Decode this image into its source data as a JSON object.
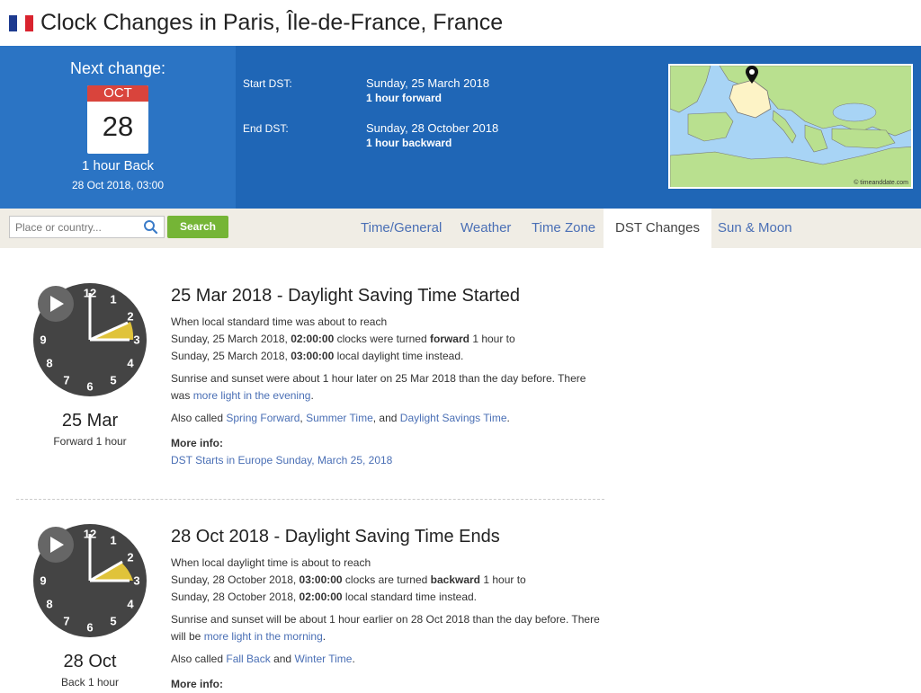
{
  "page": {
    "title": "Clock Changes in Paris, Île-de-France, France"
  },
  "colors": {
    "banner": "#1f66b6",
    "banner_left": "#2b74c4",
    "search_button": "#75b536",
    "link": "#4a6fb5",
    "calendar_month": "#d9443c"
  },
  "next_change": {
    "heading": "Next change:",
    "month": "OCT",
    "day": "28",
    "desc": "1 hour Back",
    "datetime": "28 Oct 2018, 03:00"
  },
  "dst": {
    "start_label": "Start DST:",
    "start_date": "Sunday, 25 March 2018",
    "start_note": "1 hour forward",
    "end_label": "End DST:",
    "end_date": "Sunday, 28 October 2018",
    "end_note": "1 hour backward"
  },
  "map": {
    "credit": "© timeanddate.com"
  },
  "search": {
    "placeholder": "Place or country...",
    "button": "Search"
  },
  "tabs": [
    {
      "label": "Time/General"
    },
    {
      "label": "Weather"
    },
    {
      "label": "Time Zone"
    },
    {
      "label": "DST Changes"
    },
    {
      "label": "Sun & Moon"
    }
  ],
  "events": [
    {
      "clock_date": "25 Mar",
      "clock_sub": "Forward 1 hour",
      "title": "25 Mar 2018 - Daylight Saving Time Started",
      "p1_a": "When local standard time was about to reach",
      "p1_b": "Sunday, 25 March 2018, ",
      "p1_c": "02:00:00",
      "p1_d": " clocks were turned ",
      "p1_e": "forward",
      "p1_f": " 1 hour to",
      "p1_g": "Sunday, 25 March 2018, ",
      "p1_h": "03:00:00",
      "p1_i": " local daylight time instead.",
      "p2_a": "Sunrise and sunset were about 1 hour later on 25 Mar 2018 than the day before. There was ",
      "p2_link": "more light in the evening",
      "p2_end": ".",
      "p3_a": "Also called ",
      "p3_l1": "Spring Forward",
      "p3_sep1": ", ",
      "p3_l2": "Summer Time",
      "p3_sep2": ", and ",
      "p3_l3": "Daylight Savings Time",
      "p3_end": ".",
      "more_label": "More info:",
      "more_link": "DST Starts in Europe Sunday, March 25, 2018"
    },
    {
      "clock_date": "28 Oct",
      "clock_sub": "Back 1 hour",
      "title": "28 Oct 2018 - Daylight Saving Time Ends",
      "p1_a": "When local daylight time is about to reach",
      "p1_b": "Sunday, 28 October 2018, ",
      "p1_c": "03:00:00",
      "p1_d": " clocks are turned ",
      "p1_e": "backward",
      "p1_f": " 1 hour to",
      "p1_g": "Sunday, 28 October 2018, ",
      "p1_h": "02:00:00",
      "p1_i": " local standard time instead.",
      "p2_a": "Sunrise and sunset will be about 1 hour earlier on 28 Oct 2018 than the day before. There will be ",
      "p2_link": "more light in the morning",
      "p2_end": ".",
      "p3_a": "Also called ",
      "p3_l1": "Fall Back",
      "p3_sep1": " and ",
      "p3_l2": "Winter Time",
      "p3_end": ".",
      "more_label": "More info:"
    }
  ],
  "clock_numbers": [
    "12",
    "1",
    "2",
    "3",
    "4",
    "5",
    "6",
    "7",
    "8",
    "9"
  ]
}
